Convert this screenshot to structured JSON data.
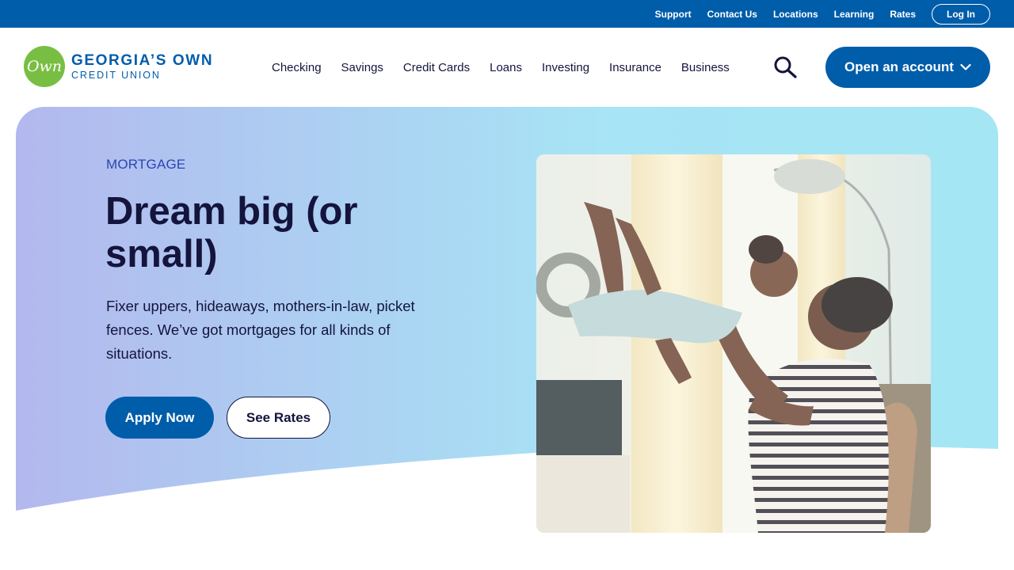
{
  "utility_nav": {
    "links": [
      "Support",
      "Contact Us",
      "Locations",
      "Learning",
      "Rates"
    ],
    "login_label": "Log In"
  },
  "brand": {
    "logo_mark": "Own",
    "name_line1": "GEORGIA’S OWN",
    "name_line2": "CREDIT UNION",
    "colors": {
      "primary_blue": "#005daa",
      "logo_green": "#78be43",
      "text_dark": "#14143c"
    }
  },
  "main_nav": {
    "items": [
      "Checking",
      "Savings",
      "Credit Cards",
      "Loans",
      "Investing",
      "Insurance",
      "Business"
    ],
    "search_icon": "search-icon",
    "cta_label": "Open an account",
    "cta_icon": "chevron-down-icon"
  },
  "hero": {
    "eyebrow": "MORTGAGE",
    "headline": "Dream big (or small)",
    "body": "Fixer uppers, hideaways, mothers-in-law, picket fences. We’ve got mortgages for all kinds of situations.",
    "primary_cta": "Apply Now",
    "secondary_cta": "See Rates",
    "image_icon": "father-lifting-child-photo"
  }
}
